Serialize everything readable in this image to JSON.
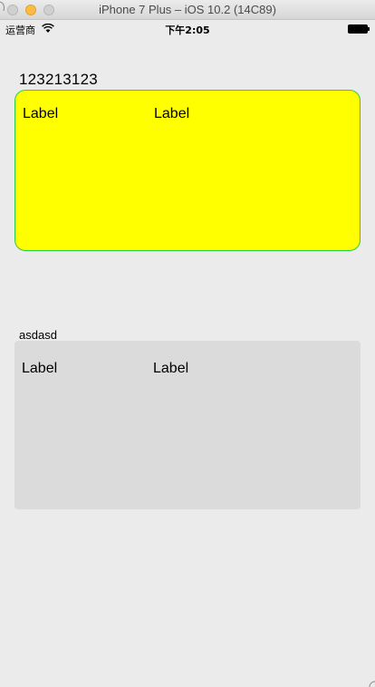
{
  "window": {
    "title": "iPhone 7 Plus – iOS 10.2 (14C89)"
  },
  "status_bar": {
    "carrier": "运营商",
    "time": "下午2:05"
  },
  "content": {
    "heading": "123213123",
    "yellow_card": {
      "left_label": "Label",
      "right_label": "Label"
    },
    "small_label": "asdasd",
    "gray_card": {
      "left_label": "Label",
      "right_label": "Label"
    }
  },
  "colors": {
    "yellow_card_fill": "#ffff00",
    "yellow_card_border": "#2ecc40",
    "gray_card_fill": "#dbdbdb",
    "background": "#ebebeb"
  }
}
